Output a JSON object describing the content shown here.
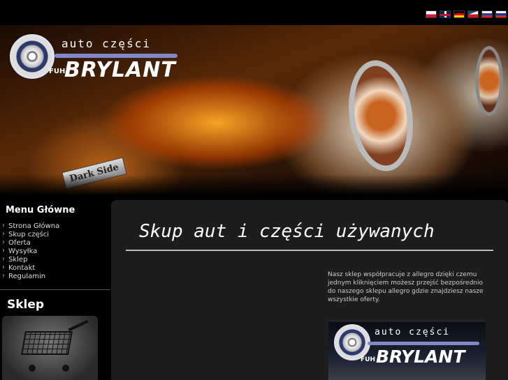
{
  "languages": [
    {
      "code": "pl",
      "icon": "flag-pl-icon"
    },
    {
      "code": "en",
      "icon": "flag-en-icon"
    },
    {
      "code": "de",
      "icon": "flag-de-icon"
    },
    {
      "code": "cz",
      "icon": "flag-cz-icon"
    },
    {
      "code": "sk",
      "icon": "flag-sk-icon"
    },
    {
      "code": "ru",
      "icon": "flag-ru-icon"
    }
  ],
  "logo": {
    "tagline": "auto części",
    "prefix": "FUH",
    "brand": "BRYLANT"
  },
  "banner": {
    "badge": "Dark Side"
  },
  "sidebar": {
    "menu_title": "Menu Główne",
    "items": [
      {
        "label": "Strona Główna"
      },
      {
        "label": "Skup części"
      },
      {
        "label": "Oferta"
      },
      {
        "label": "Wysyłka"
      },
      {
        "label": "Sklep"
      },
      {
        "label": "Kontakt"
      },
      {
        "label": "Regulamin"
      }
    ],
    "shop_title": "Sklep"
  },
  "main": {
    "title": "Skup aut i części używanych",
    "intro": "Nasz sklep współpracuje z allegro dzięki czemu jednym kliknięciem możesz przejść bezpośrednio do naszego sklepu allegro gdzie znajdziesz nasze wszystkie oferty.",
    "promo": {
      "tagline": "auto części",
      "prefix": "FUH",
      "brand": "BRYLANT"
    }
  },
  "colors": {
    "background": "#000000",
    "content_panel": "#1d1d1d",
    "logo_accent": "#7f89c6",
    "logo_wheel": "#2b3a6b"
  }
}
